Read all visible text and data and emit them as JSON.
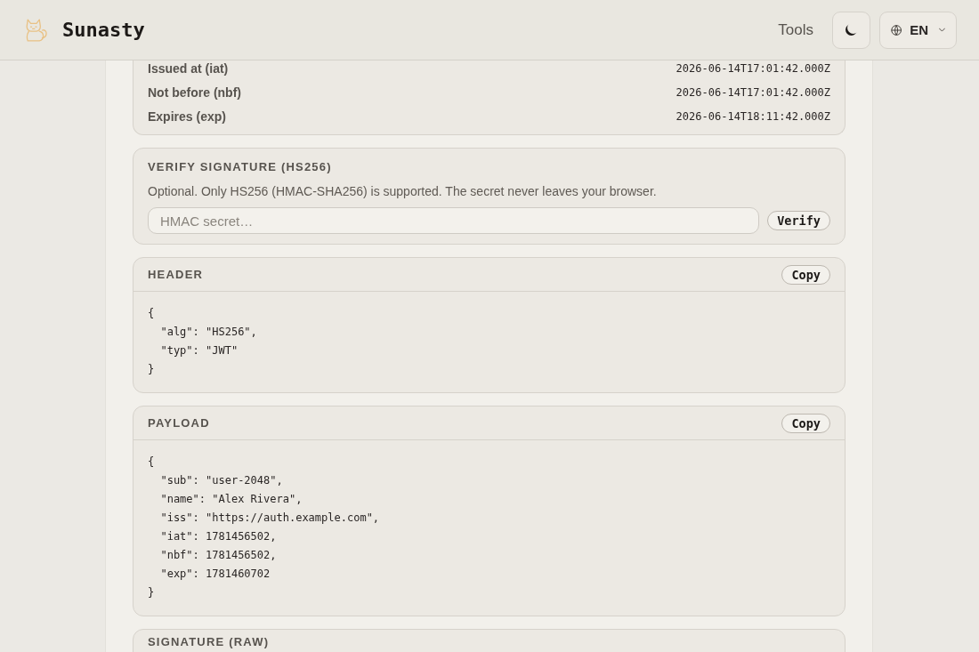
{
  "header": {
    "brand": "Sunasty",
    "nav": [
      {
        "label": "Tools"
      }
    ],
    "language": {
      "label": "EN"
    }
  },
  "claims": {
    "rows": [
      {
        "label": "Issued at (iat)",
        "value": "2026-06-14T17:01:42.000Z"
      },
      {
        "label": "Not before (nbf)",
        "value": "2026-06-14T17:01:42.000Z"
      },
      {
        "label": "Expires (exp)",
        "value": "2026-06-14T18:11:42.000Z"
      }
    ]
  },
  "verify": {
    "title": "VERIFY SIGNATURE (HS256)",
    "description": "Optional. Only HS256 (HMAC-SHA256) is supported. The secret never leaves your browser.",
    "secret_field": {
      "placeholder": "HMAC secret…"
    },
    "button": "Verify"
  },
  "sections": [
    {
      "title": "HEADER",
      "copy_button": "Copy",
      "code": [
        "{",
        "  \"alg\": \"HS256\",",
        "  \"typ\": \"JWT\"",
        "}"
      ]
    },
    {
      "title": "PAYLOAD",
      "copy_button": "Copy",
      "code": [
        "{",
        "  \"sub\": \"user-2048\",",
        "  \"name\": \"Alex Rivera\",",
        "  \"iss\": \"https://auth.example.com\",",
        "  \"iat\": 1781456502,",
        "  \"nbf\": 1781456502,",
        "  \"exp\": 1781460702",
        "}"
      ]
    }
  ],
  "signature": {
    "title": "SIGNATURE (RAW)"
  }
}
